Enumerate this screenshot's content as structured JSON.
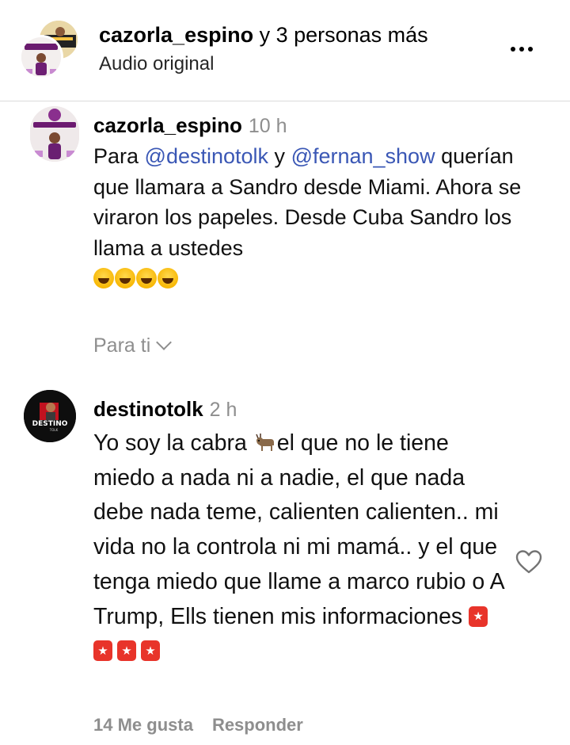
{
  "header": {
    "username": "cazorla_espino",
    "title_rest": " y 3 personas más",
    "subtitle": "Audio original",
    "more_icon": "more-horizontal-icon"
  },
  "comments": [
    {
      "username": "cazorla_espino",
      "time": "10 h",
      "text_prefix": "Para ",
      "mention1": "@destinotolk",
      "text_mid": "  y ",
      "mention2": "@fernan_show",
      "text_rest": " querían que llamara a Sandro desde Miami. Ahora se viraron los papeles. Desde Cuba Sandro los llama a ustedes",
      "emoji": "rolling-on-floor-laughing x4",
      "for_you_label": "Para ti"
    },
    {
      "username": "destinotolk",
      "time": "2 h",
      "text_prefix": "Yo soy la cabra ",
      "text_rest": "el que no le tiene miedo a nada ni a nadie, el que nada debe nada teme, calienten calienten.. mi vida no la controla ni mi mamá.. y el que tenga miedo que llame a marco rubio o A Trump, Ells tienen mis informaciones",
      "emoji_inline": "goat",
      "emoji_trailing": "rotating-light x4",
      "likes": "14 Me gusta",
      "reply_label": "Responder",
      "like_icon": "heart-outline-icon"
    }
  ],
  "colors": {
    "mention": "#3a57b5",
    "muted": "#8e8e8e",
    "divider": "#dbdbdb"
  }
}
